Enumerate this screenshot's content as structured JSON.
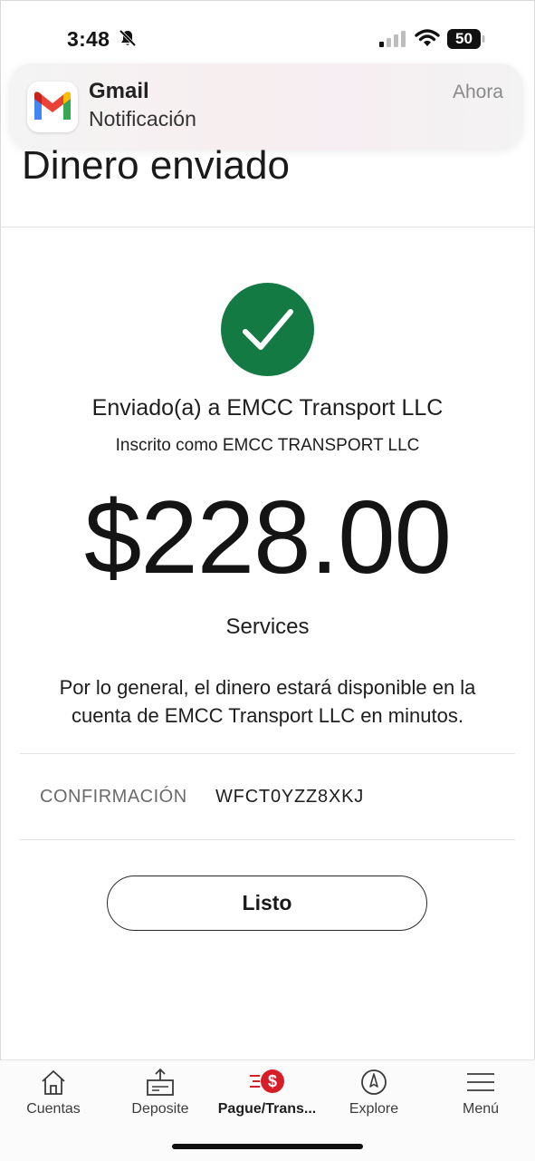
{
  "status_bar": {
    "time": "3:48",
    "battery": "50"
  },
  "notification": {
    "app": "Gmail",
    "body": "Notificación",
    "time": "Ahora",
    "icon": "gmail-icon"
  },
  "page": {
    "title": "Dinero enviado"
  },
  "confirmation": {
    "status_icon": "check-icon",
    "status_color": "#147a44",
    "sent_to": "Enviado(a) a EMCC Transport LLC",
    "registered_as": "Inscrito como EMCC TRANSPORT LLC",
    "amount": "$228.00",
    "memo": "Services",
    "availability": "Por lo general, el dinero estará disponible en la cuenta de EMCC Transport LLC en minutos.",
    "confirmation_label": "CONFIRMACIÓN",
    "confirmation_number": "WFCT0YZZ8XKJ",
    "done_label": "Listo"
  },
  "tab_bar": {
    "items": [
      {
        "label": "Cuentas",
        "icon": "home-icon"
      },
      {
        "label": "Deposite",
        "icon": "deposit-icon"
      },
      {
        "label": "Pague/Trans...",
        "icon": "pay-transfer-icon",
        "active": true
      },
      {
        "label": "Explore",
        "icon": "compass-icon"
      },
      {
        "label": "Menú",
        "icon": "menu-icon"
      }
    ],
    "accent": "#d71e28"
  }
}
